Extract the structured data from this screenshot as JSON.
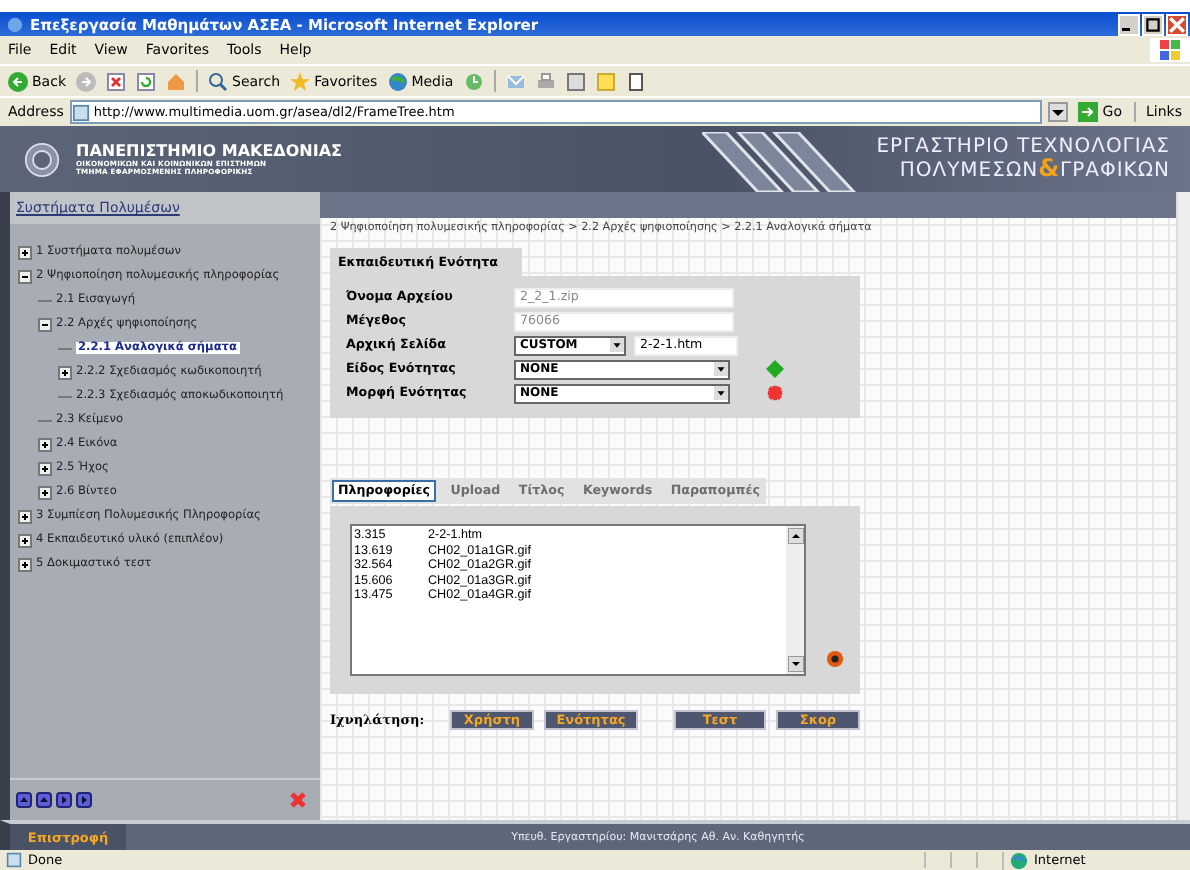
{
  "window": {
    "title": "Επεξεργασία Μαθημάτων ΑΣΕΑ - Microsoft Internet Explorer"
  },
  "menu": [
    "File",
    "Edit",
    "View",
    "Favorites",
    "Tools",
    "Help"
  ],
  "toolbar": {
    "back": "Back",
    "search": "Search",
    "favorites": "Favorites",
    "media": "Media"
  },
  "address": {
    "label": "Address",
    "value": "http://www.multimedia.uom.gr/asea/dl2/FrameTree.htm",
    "go": "Go",
    "links": "Links"
  },
  "banner": {
    "university": "ΠΑΝΕΠΙΣΤΗΜΙΟ ΜΑΚΕΔΟΝΙΑΣ",
    "school": "ΟΙΚΟΝΟΜΙΚΩΝ ΚΑΙ ΚΟΙΝΩΝΙΚΩΝ ΕΠΙΣΤΗΜΩΝ",
    "department": "ΤΜΗΜΑ ΕΦΑΡΜΟΣΜΕΝΗΣ ΠΛΗΡΟΦΟΡΙΚΗΣ",
    "lab_line1": "ΕΡΓΑΣΤΗΡΙΟ ΤΕΧΝΟΛΟΓΙΑΣ",
    "lab_line2a": "ΠΟΛΥΜΕΣΩΝ",
    "amp": "&",
    "lab_line2b": "ΓΡΑΦΙΚΩΝ"
  },
  "sidebar": {
    "title": "Συστήματα Πολυμέσων",
    "tree": [
      {
        "label": "1 Συστήματα πολυμέσων",
        "expanded": false,
        "selected": false
      },
      {
        "label": "2 Ψηφιοποίηση πολυμεσικής πληροφορίας",
        "expanded": true,
        "selected": false,
        "children": [
          {
            "label": "2.1 Εισαγωγή",
            "selected": false
          },
          {
            "label": "2.2 Αρχές ψηφιοποίησης",
            "expanded": true,
            "selected": false,
            "children": [
              {
                "label": "2.2.1 Αναλογικά σήματα",
                "selected": true
              },
              {
                "label": "2.2.2 Σχεδιασμός κωδικοποιητή",
                "expanded": false,
                "selected": false
              },
              {
                "label": "2.2.3 Σχεδιασμός αποκωδικοποιητή",
                "selected": false
              }
            ]
          },
          {
            "label": "2.3 Κείμενο",
            "selected": false
          },
          {
            "label": "2.4 Εικόνα",
            "expanded": false,
            "selected": false
          },
          {
            "label": "2.5 Ήχος",
            "expanded": false,
            "selected": false
          },
          {
            "label": "2.6 Βίντεο",
            "expanded": false,
            "selected": false
          }
        ]
      },
      {
        "label": "3 Συμπίεση Πολυμεσικής Πληροφορίας",
        "expanded": false,
        "selected": false
      },
      {
        "label": "4 Εκπαιδευτικό υλικό (επιπλέον)",
        "expanded": false,
        "selected": false
      },
      {
        "label": "5 Δοκιμαστικό τεστ",
        "expanded": false,
        "selected": false
      }
    ]
  },
  "breadcrumb": "2 Ψηφιοποίηση πολυμεσικής πληροφορίας > 2.2 Αρχές ψηφιοποίησης >  2.2.1 Αναλογικά σήματα",
  "unit_panel": {
    "tab": "Εκπαιδευτική Ενότητα",
    "fields": [
      {
        "kind": "text",
        "label": "Όνομα Αρχείου",
        "value": "2_2_1.zip"
      },
      {
        "kind": "text",
        "label": "Μέγεθος",
        "value": "76066"
      },
      {
        "kind": "select-text",
        "label": "Αρχική Σελίδα",
        "select": "CUSTOM",
        "value": "2-2-1.htm"
      },
      {
        "kind": "select",
        "label": "Είδος Ενότητας",
        "select": "NONE"
      },
      {
        "kind": "select",
        "label": "Μορφή Ενότητας",
        "select": "NONE"
      }
    ]
  },
  "tabs": [
    {
      "label": "Πληροφορίες",
      "selected": true
    },
    {
      "label": "Upload",
      "selected": false
    },
    {
      "label": "Τίτλος",
      "selected": false
    },
    {
      "label": "Keywords",
      "selected": false
    },
    {
      "label": "Παραπομπές",
      "selected": false
    }
  ],
  "files": [
    {
      "size": "3.315",
      "name": "2-2-1.htm"
    },
    {
      "size": "13.619",
      "name": "CH02_01a1GR.gif"
    },
    {
      "size": "32.564",
      "name": "CH02_01a2GR.gif"
    },
    {
      "size": "15.606",
      "name": "CH02_01a3GR.gif"
    },
    {
      "size": "13.475",
      "name": "CH02_01a4GR.gif"
    }
  ],
  "tracking": {
    "label": "Ιχνηλάτηση:",
    "buttons": [
      "Χρήστη",
      "Ενότητας",
      "Τεστ",
      "Σκορ"
    ]
  },
  "footer": {
    "back": "Επιστροφή",
    "credit": "Υπευθ. Εργαστηρίου: Μανιτσάρης Αθ. Αν. Καθηγητής"
  },
  "status_bar": {
    "text": "Done",
    "zone": "Internet"
  }
}
